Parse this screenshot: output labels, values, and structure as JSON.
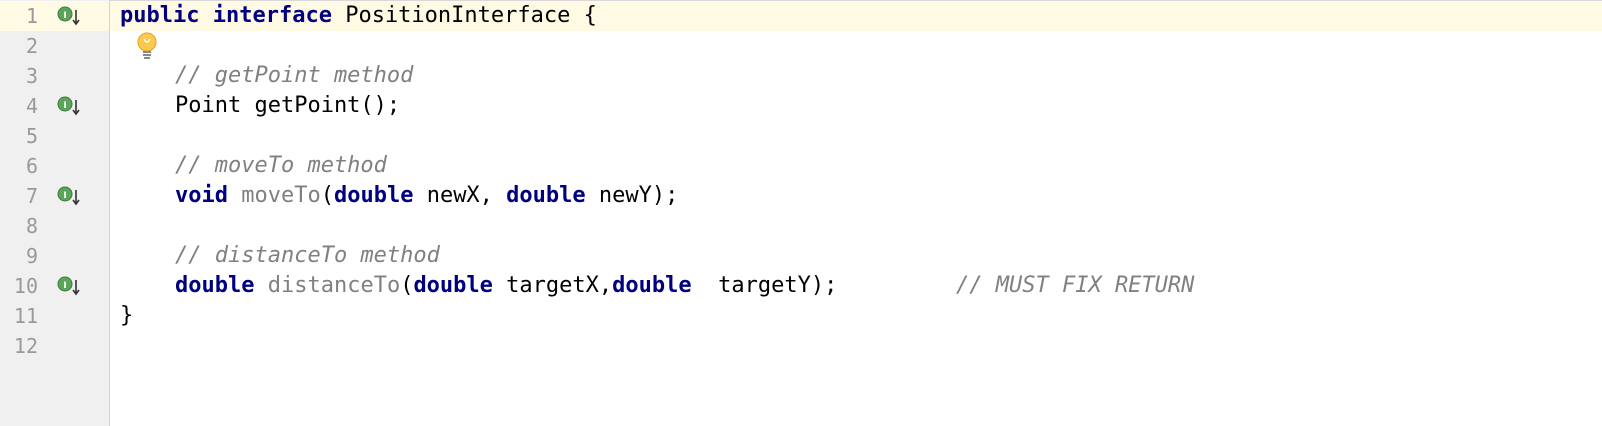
{
  "editor": {
    "lines": [
      {
        "num": "1",
        "has_impl_icon": true
      },
      {
        "num": "2",
        "has_impl_icon": false
      },
      {
        "num": "3",
        "has_impl_icon": false
      },
      {
        "num": "4",
        "has_impl_icon": true
      },
      {
        "num": "5",
        "has_impl_icon": false
      },
      {
        "num": "6",
        "has_impl_icon": false
      },
      {
        "num": "7",
        "has_impl_icon": true
      },
      {
        "num": "8",
        "has_impl_icon": false
      },
      {
        "num": "9",
        "has_impl_icon": false
      },
      {
        "num": "10",
        "has_impl_icon": true
      },
      {
        "num": "11",
        "has_impl_icon": false
      },
      {
        "num": "12",
        "has_impl_icon": false
      }
    ],
    "code": {
      "l1": {
        "kw1": "public",
        "kw2": "interface",
        "name": "PositionInterface {"
      },
      "l3": {
        "comment": "// getPoint method"
      },
      "l4": {
        "text": "Point getPoint();"
      },
      "l6": {
        "comment": "// moveTo method"
      },
      "l7": {
        "kw_void": "void",
        "method": "moveTo",
        "open": "(",
        "kw_d1": "double",
        "p1": " newX, ",
        "kw_d2": "double",
        "p2": " newY);"
      },
      "l9": {
        "comment": "// distanceTo method"
      },
      "l10": {
        "kw_ret": "double",
        "method": "distanceTo",
        "open": "(",
        "kw_d1": "double",
        "p1": " targetX,",
        "kw_d2": "double",
        "p2": "  targetY);",
        "comment": "// MUST FIX RETURN"
      },
      "l11": {
        "text": "}"
      }
    },
    "icons": {
      "implemented": "implemented-method-icon",
      "intention": "lightbulb-icon"
    },
    "colors": {
      "keyword": "#000080",
      "comment": "#808080",
      "current_line": "#fffae3",
      "gutter": "#f0f0f0",
      "line_number": "#999999"
    }
  }
}
